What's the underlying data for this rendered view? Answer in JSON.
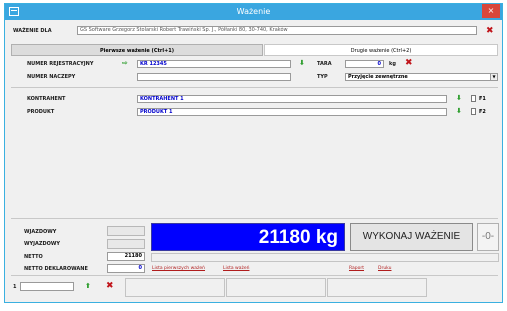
{
  "window": {
    "title": "Ważenie",
    "close": "×"
  },
  "header": {
    "label": "WAŻENIE DLA",
    "value": "GS Software Grzegorz Stolarski Robert Trawiński Sp. J., Półłanki 80, 30-740, Kraków"
  },
  "tabs": [
    {
      "label": "Pierwsze ważenie (Ctrl+1)",
      "active": true
    },
    {
      "label": "Drugie ważenie (Ctrl+2)",
      "active": false
    }
  ],
  "form": {
    "reg_label": "NUMER REJESTRACYJNY",
    "reg_value": "KR 12345",
    "tara_label": "TARA",
    "tara_value": "0",
    "tara_unit": "kg",
    "trailer_label": "NUMER NACZEPY",
    "trailer_value": "",
    "type_label": "TYP",
    "type_value": "Przyjęcie zewnętrzne",
    "contractor_label": "KONTRAHENT",
    "contractor_value": "KONTRAHENT 1",
    "contractor_key": "F1",
    "product_label": "PRODUKT",
    "product_value": "PRODUKT 1",
    "product_key": "F2"
  },
  "bottom": {
    "entry_label": "WJAZDOWY",
    "exit_label": "WYJAZDOWY",
    "netto_label": "NETTO",
    "netto_value": "21180",
    "declared_label": "NETTO DEKLAROWANE",
    "declared_value": "0",
    "display": "21180 kg",
    "weigh_button": "WYKONAJ WAŻENIE",
    "zero_button": "-0-",
    "links": [
      "Lista pierwszych ważeń",
      "Lista ważeń",
      "Raport",
      "Druku"
    ]
  },
  "statusbar": {
    "counter": "1"
  },
  "colors": {
    "accent": "#3aa6e0",
    "display_bg": "#0000ff",
    "link": "#b01c1c"
  }
}
